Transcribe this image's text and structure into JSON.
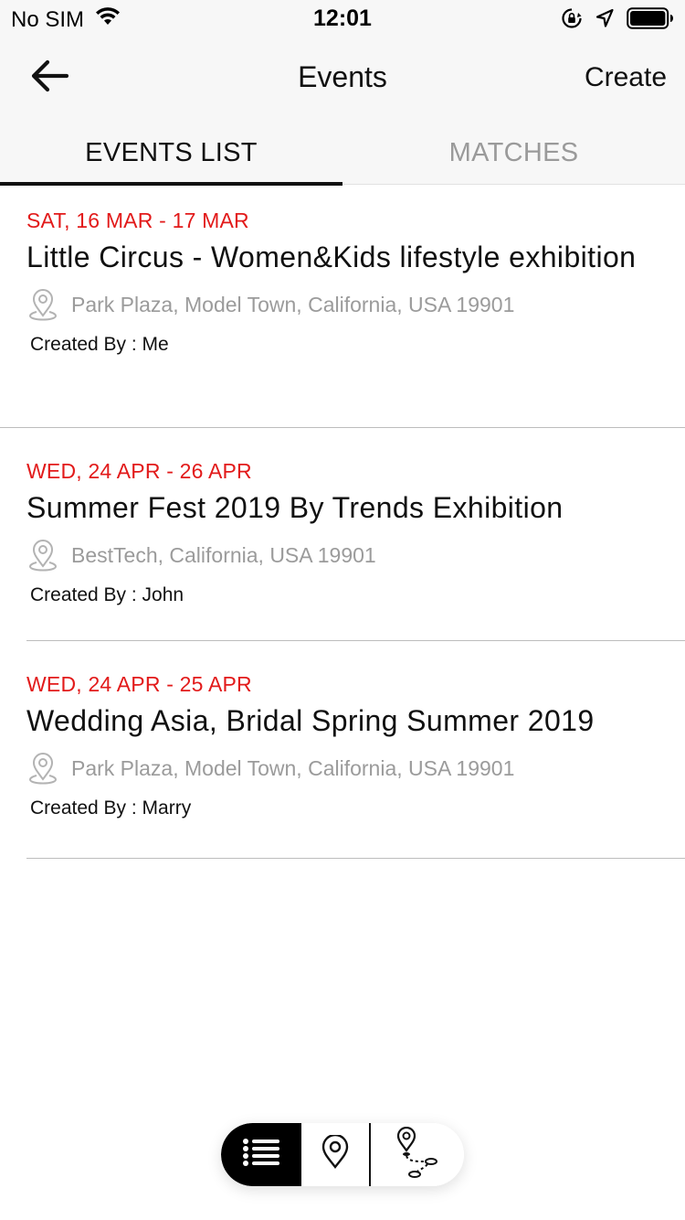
{
  "status_bar": {
    "carrier": "No SIM",
    "time": "12:01",
    "icons": [
      "wifi-icon",
      "orientation-lock-icon",
      "location-arrow-icon",
      "battery-icon"
    ]
  },
  "nav": {
    "title": "Events",
    "create_label": "Create",
    "back_icon": "back-arrow-icon"
  },
  "tabs": [
    {
      "label": "EVENTS LIST",
      "active": true
    },
    {
      "label": "MATCHES",
      "active": false
    }
  ],
  "events": [
    {
      "date": "SAT, 16 MAR - 17 MAR",
      "title": "Little Circus - Women&Kids lifestyle exhibition",
      "location": "Park Plaza,  Model Town, California, USA 19901",
      "created_by": "Created By : Me"
    },
    {
      "date": "WED, 24 APR - 26 APR",
      "title": "Summer Fest 2019 By Trends Exhibition",
      "location": "BestTech, California, USA 19901",
      "created_by": "Created By : John"
    },
    {
      "date": "WED, 24 APR - 25 APR",
      "title": "Wedding Asia, Bridal Spring Summer 2019",
      "location": "Park Plaza,  Model Town, California, USA 19901",
      "created_by": "Created By : Marry"
    }
  ],
  "bottom_control": {
    "segments": [
      "list-icon",
      "map-pin-icon",
      "route-icon"
    ],
    "selected": "list-icon"
  },
  "colors": {
    "accent_date": "#e21a1a",
    "secondary_text": "#9b9b9b",
    "bar_background": "#f7f7f7"
  }
}
